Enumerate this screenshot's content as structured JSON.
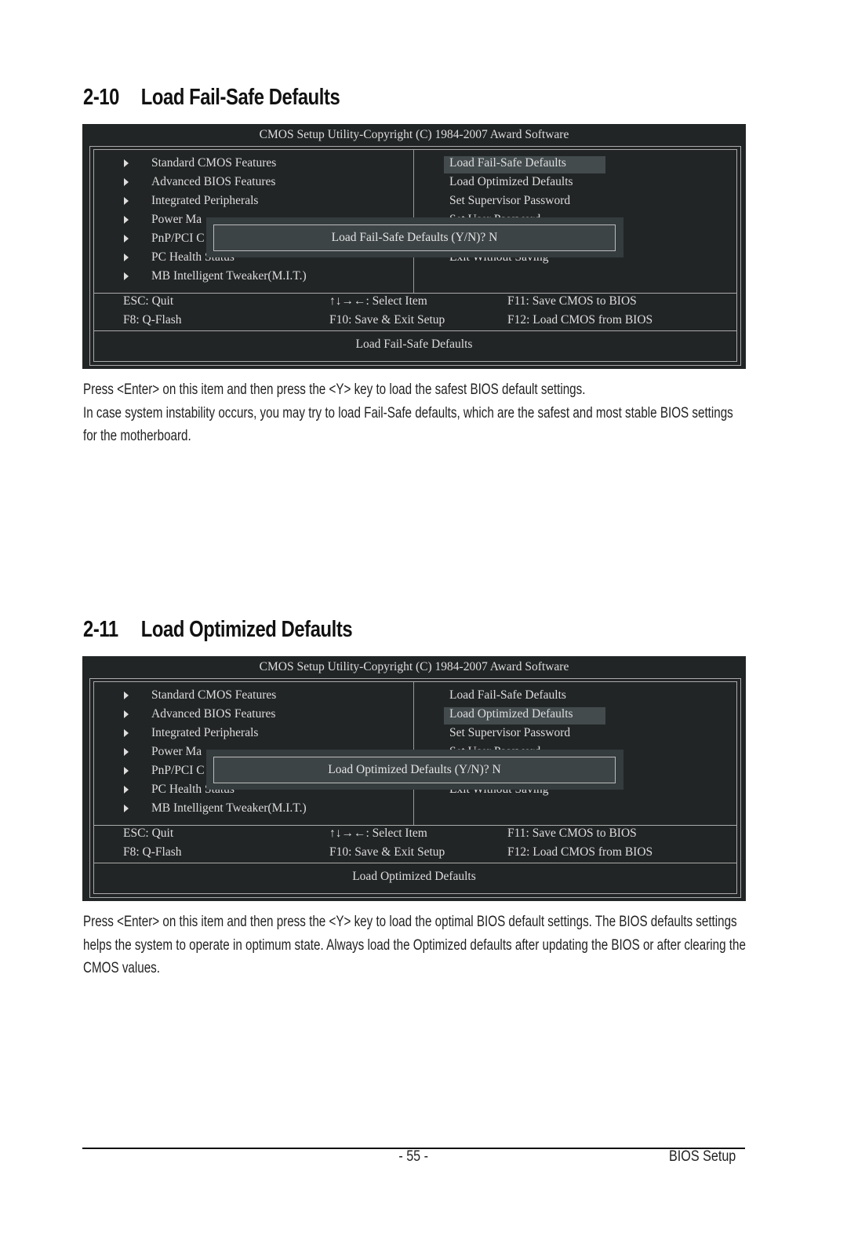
{
  "sections": [
    {
      "number": "2-10",
      "title": "Load Fail-Safe Defaults",
      "bios": {
        "header": "CMOS Setup Utility-Copyright (C) 1984-2007 Award Software",
        "left_menu": [
          "Standard CMOS Features",
          "Advanced BIOS Features",
          "Integrated Peripherals",
          "Power Ma",
          "PnP/PCI C",
          "PC Health Status",
          "MB Intelligent Tweaker(M.I.T.)"
        ],
        "right_menu": [
          "Load Fail-Safe Defaults",
          "Load Optimized Defaults",
          "Set Supervisor Password",
          "Set User Password",
          "",
          "Exit Without Saving"
        ],
        "selected_index": 0,
        "dialog": "Load Fail-Safe Defaults (Y/N)? N",
        "keys": {
          "esc": "ESC: Quit",
          "f8": "F8: Q-Flash",
          "select": "↑↓→←: Select Item",
          "f10": "F10: Save & Exit Setup",
          "f11": "F11: Save CMOS to BIOS",
          "f12": "F12: Load CMOS from BIOS"
        },
        "status": "Load Fail-Safe Defaults"
      },
      "paragraphs": [
        "Press <Enter> on this item and then press the <Y> key to load the safest BIOS default settings.",
        "In case system instability occurs, you may try to load Fail-Safe defaults, which are the safest and most stable BIOS settings for the motherboard."
      ]
    },
    {
      "number": "2-11",
      "title": "Load Optimized Defaults",
      "bios": {
        "header": "CMOS Setup Utility-Copyright (C) 1984-2007 Award Software",
        "left_menu": [
          "Standard CMOS Features",
          "Advanced BIOS Features",
          "Integrated Peripherals",
          "Power Ma",
          "PnP/PCI C",
          "PC Health Status",
          "MB Intelligent Tweaker(M.I.T.)"
        ],
        "right_menu": [
          "Load Fail-Safe Defaults",
          "Load Optimized Defaults",
          "Set Supervisor Password",
          "Set User Password",
          "",
          "Exit Without Saving"
        ],
        "selected_index": 1,
        "dialog": "Load Optimized Defaults (Y/N)? N",
        "keys": {
          "esc": "ESC: Quit",
          "f8": "F8: Q-Flash",
          "select": "↑↓→←: Select Item",
          "f10": "F10: Save & Exit Setup",
          "f11": "F11: Save CMOS to BIOS",
          "f12": "F12: Load CMOS from BIOS"
        },
        "status": "Load Optimized Defaults"
      },
      "paragraphs": [
        "Press <Enter> on this item and then press the <Y> key to load the optimal BIOS default settings. The BIOS defaults settings helps the system to operate in optimum state. Always load the Optimized defaults after updating the BIOS or after clearing the CMOS values."
      ]
    }
  ],
  "footer": {
    "page": "- 55 -",
    "section": "BIOS Setup"
  }
}
